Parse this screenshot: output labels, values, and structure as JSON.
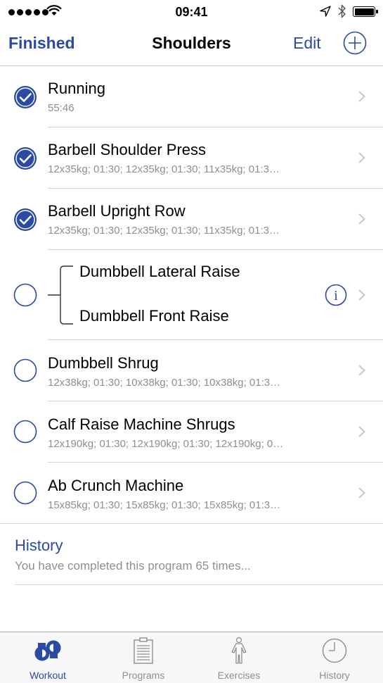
{
  "status_bar": {
    "time": "09:41",
    "signal_icon": "signal-dots-icon",
    "wifi_icon": "wifi-icon",
    "location_icon": "location-arrow-icon",
    "bluetooth_icon": "bluetooth-icon",
    "battery_icon": "battery-full-icon"
  },
  "nav": {
    "left_label": "Finished",
    "title": "Shoulders",
    "edit_label": "Edit",
    "add_icon": "plus-circle-icon"
  },
  "exercises": [
    {
      "title": "Running",
      "subtitle": "55:46",
      "completed": true
    },
    {
      "title": "Barbell Shoulder Press",
      "subtitle": "12x35kg; 01:30; 12x35kg; 01:30; 11x35kg; 01:3…",
      "completed": true
    },
    {
      "title": "Barbell Upright Row",
      "subtitle": "12x35kg; 01:30; 12x35kg; 01:30; 11x35kg; 01:3…",
      "completed": true
    }
  ],
  "superset": {
    "completed": false,
    "titles": [
      "Dumbbell Lateral Raise",
      "Dumbbell Front Raise"
    ],
    "info_icon": "info-icon"
  },
  "exercises_after": [
    {
      "title": "Dumbbell Shrug",
      "subtitle": "12x38kg; 01:30; 10x38kg; 01:30; 10x38kg; 01:3…",
      "completed": false
    },
    {
      "title": "Calf Raise Machine Shrugs",
      "subtitle": "12x190kg; 01:30; 12x190kg; 01:30; 12x190kg; 0…",
      "completed": false
    },
    {
      "title": "Ab Crunch Machine",
      "subtitle": "15x85kg; 01:30; 15x85kg; 01:30; 15x85kg; 01:3…",
      "completed": false
    }
  ],
  "history": {
    "title": "History",
    "subtitle": "You have completed this program 65 times..."
  },
  "tabs": [
    {
      "label": "Workout",
      "icon": "workout-icon",
      "active": true
    },
    {
      "label": "Programs",
      "icon": "clipboard-icon",
      "active": false
    },
    {
      "label": "Exercises",
      "icon": "body-figure-icon",
      "active": false
    },
    {
      "label": "History",
      "icon": "clock-icon",
      "active": false
    }
  ],
  "colors": {
    "accent": "#2a4aa3",
    "secondary_text": "#8e8e93",
    "separator": "#d6d6da"
  }
}
